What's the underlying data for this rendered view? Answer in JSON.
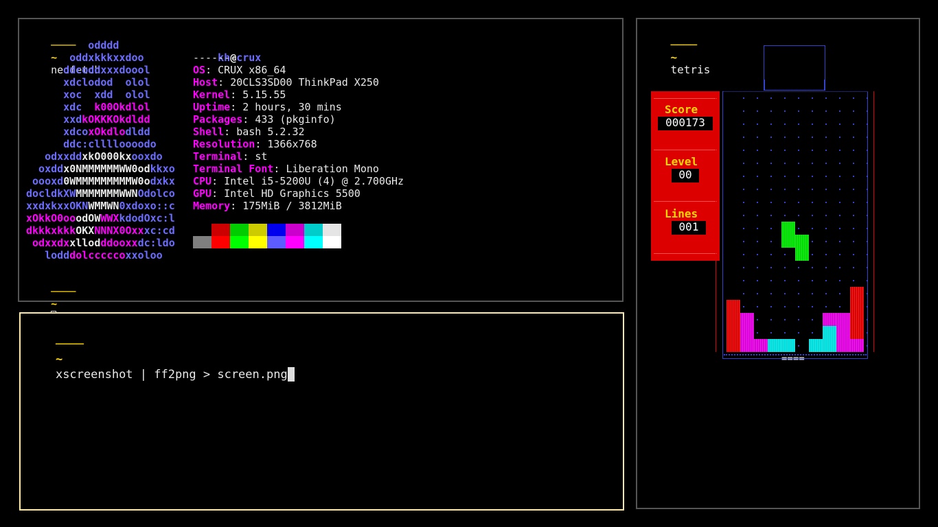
{
  "neofetch_window": {
    "prompt_dash": "────",
    "prompt_tilde": "~",
    "command": "neofetch",
    "logo_lines": [
      [
        [
          "b",
          "          odddd"
        ]
      ],
      [
        [
          "b",
          "       oddxkkkxxdoo"
        ]
      ],
      [
        [
          "b",
          "      ddcoddxxxdoool"
        ]
      ],
      [
        [
          "b",
          "      xdclodod  olol"
        ]
      ],
      [
        [
          "b",
          "      xoc  xdd  olol"
        ]
      ],
      [
        [
          "b",
          "      xdc  "
        ],
        [
          "m",
          "k00Okdlol"
        ]
      ],
      [
        [
          "b",
          "      xxd"
        ],
        [
          "m",
          "kOKKKOkdldd"
        ]
      ],
      [
        [
          "b",
          "      xdco"
        ],
        [
          "m",
          "xOkdlo"
        ],
        [
          "b",
          "dldd"
        ]
      ],
      [
        [
          "b",
          "      ddc:cllll"
        ],
        [
          "b",
          "oooodo"
        ]
      ],
      [
        [
          "b",
          "   odxxdd"
        ],
        [
          "w",
          "xkO000kx"
        ],
        [
          "b",
          "ooxdo"
        ]
      ],
      [
        [
          "b",
          "  oxdd"
        ],
        [
          "w",
          "x0NMMMMMMWW0od"
        ],
        [
          "b",
          "kkxo"
        ]
      ],
      [
        [
          "b",
          " oooxd"
        ],
        [
          "w",
          "0WMMMMMMMMMW0o"
        ],
        [
          "b",
          "dxkx"
        ]
      ],
      [
        [
          "b",
          "docldkXW"
        ],
        [
          "w",
          "MMMMMMMWWN"
        ],
        [
          "b",
          "Odolco"
        ]
      ],
      [
        [
          "b",
          "xxdx"
        ],
        [
          "b",
          "kxxOKN"
        ],
        [
          "w",
          "WMMWN"
        ],
        [
          "b",
          "0xdoxo::c"
        ]
      ],
      [
        [
          "m",
          "xOkkO0oo"
        ],
        [
          "w",
          "odOW"
        ],
        [
          "m",
          "WWX"
        ],
        [
          "b",
          "kdodOxc:l"
        ]
      ],
      [
        [
          "m",
          "dkkkxkkk"
        ],
        [
          "w",
          "OKX"
        ],
        [
          "m",
          "NNNX0Oxx"
        ],
        [
          "b",
          "xc:cd"
        ]
      ],
      [
        [
          "m",
          " odxxdx"
        ],
        [
          "w",
          "xllod"
        ],
        [
          "m",
          "ddooxx"
        ],
        [
          "b",
          "dc:ldo"
        ]
      ],
      [
        [
          "b",
          "   lodd"
        ],
        [
          "m",
          "dolccccco"
        ],
        [
          "b",
          "xxoloo"
        ]
      ]
    ],
    "user": "kh",
    "at": "@",
    "host": "crux",
    "separator": "-------",
    "info": [
      {
        "key": "OS",
        "value": "CRUX x86_64"
      },
      {
        "key": "Host",
        "value": "20CLS3SD00 ThinkPad X250"
      },
      {
        "key": "Kernel",
        "value": "5.15.55"
      },
      {
        "key": "Uptime",
        "value": "2 hours, 30 mins"
      },
      {
        "key": "Packages",
        "value": "433 (pkginfo)"
      },
      {
        "key": "Shell",
        "value": "bash 5.2.32"
      },
      {
        "key": "Resolution",
        "value": "1366x768"
      },
      {
        "key": "Terminal",
        "value": "st"
      },
      {
        "key": "Terminal Font",
        "value": "Liberation Mono"
      },
      {
        "key": "CPU",
        "value": "Intel i5-5200U (4) @ 2.700GHz"
      },
      {
        "key": "GPU",
        "value": "Intel HD Graphics 5500"
      },
      {
        "key": "Memory",
        "value": "175MiB / 3812MiB"
      }
    ],
    "palette_row1": [
      "#000000",
      "#cc0000",
      "#00cc00",
      "#cccc00",
      "#0000ee",
      "#cc00cc",
      "#00cccc",
      "#e5e5e5"
    ],
    "palette_row2": [
      "#7f7f7f",
      "#ff0000",
      "#00ff00",
      "#ffff00",
      "#5c5cff",
      "#ff00ff",
      "#00ffff",
      "#ffffff"
    ]
  },
  "shell_window": {
    "prompt_dash": "────",
    "prompt_tilde": "~",
    "command": "xscreenshot | ff2png > screen.png"
  },
  "tetris_window": {
    "prompt_dash": "────",
    "prompt_tilde": "~",
    "command": "tetris",
    "score_label": "Score",
    "score_value": "000173",
    "level_label": "Level",
    "level_value": "00",
    "lines_label": "Lines",
    "lines_value": "001",
    "bottom_marker": "====",
    "colors": {
      "red": "#dd0000",
      "magenta": "#dd00dd",
      "cyan": "#00dddd",
      "green": "#00dd00",
      "panel": "#dd0000",
      "well_border": "#3344cc"
    },
    "active_piece": [
      [
        4,
        9
      ],
      [
        4,
        10
      ],
      [
        5,
        10
      ],
      [
        5,
        11
      ]
    ],
    "board": [
      {
        "c": 0,
        "r": 15,
        "color": "red"
      },
      {
        "c": 0,
        "r": 16,
        "color": "red"
      },
      {
        "c": 0,
        "r": 17,
        "color": "red"
      },
      {
        "c": 0,
        "r": 18,
        "color": "red"
      },
      {
        "c": 1,
        "r": 16,
        "color": "magenta"
      },
      {
        "c": 1,
        "r": 17,
        "color": "magenta"
      },
      {
        "c": 1,
        "r": 18,
        "color": "magenta"
      },
      {
        "c": 2,
        "r": 18,
        "color": "magenta"
      },
      {
        "c": 3,
        "r": 18,
        "color": "cyan"
      },
      {
        "c": 4,
        "r": 18,
        "color": "cyan"
      },
      {
        "c": 6,
        "r": 18,
        "color": "cyan"
      },
      {
        "c": 7,
        "r": 17,
        "color": "cyan"
      },
      {
        "c": 7,
        "r": 18,
        "color": "cyan"
      },
      {
        "c": 7,
        "r": 16,
        "color": "magenta"
      },
      {
        "c": 8,
        "r": 16,
        "color": "magenta"
      },
      {
        "c": 8,
        "r": 17,
        "color": "magenta"
      },
      {
        "c": 8,
        "r": 18,
        "color": "magenta"
      },
      {
        "c": 9,
        "r": 14,
        "color": "red"
      },
      {
        "c": 9,
        "r": 15,
        "color": "red"
      },
      {
        "c": 9,
        "r": 16,
        "color": "red"
      },
      {
        "c": 9,
        "r": 17,
        "color": "red"
      },
      {
        "c": 9,
        "r": 18,
        "color": "magenta"
      }
    ]
  }
}
